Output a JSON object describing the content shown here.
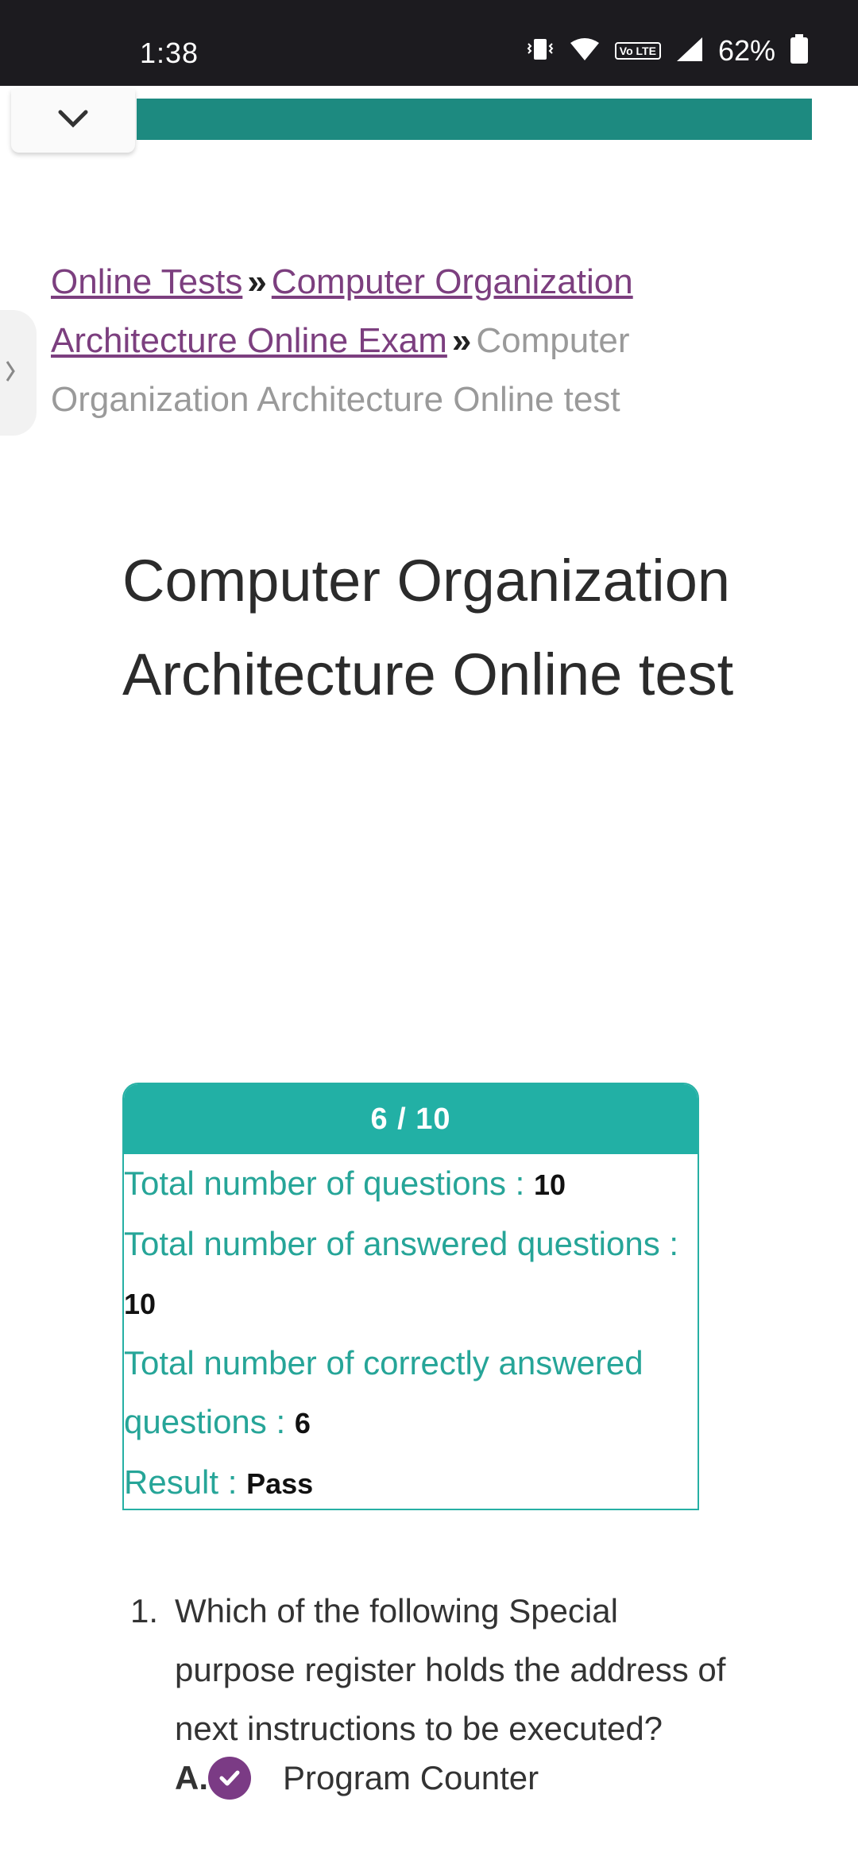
{
  "status_bar": {
    "time": "1:38",
    "battery": "62%",
    "network_badge": "Vo LTE",
    "icons": [
      "vibrate-icon",
      "wifi-icon",
      "volte-icon",
      "signal-icon",
      "battery-icon"
    ]
  },
  "breadcrumb": {
    "link1": "Online Tests",
    "link2": "Computer Organization Architecture Online Exam",
    "current": "Computer Organization Architecture Online test",
    "separator": "»"
  },
  "page_title": "Computer Organization Architecture Online test",
  "result": {
    "score": "6 / 10",
    "total_label": "Total number of questions : ",
    "total_value": "10",
    "answered_label": "Total number of answered questions : ",
    "answered_value": "10",
    "correct_label": "Total number of correctly answered questions : ",
    "correct_value": "6",
    "result_label": "Result : ",
    "result_value": "Pass"
  },
  "question": {
    "number": "1.",
    "text": "Which of the following Special purpose register holds the address of next instructions to be executed?",
    "option_letter": "A.",
    "option_text": "Program Counter"
  },
  "colors": {
    "teal": "#22b0a5",
    "link": "#7c3f7f",
    "check": "#7b3b85"
  }
}
